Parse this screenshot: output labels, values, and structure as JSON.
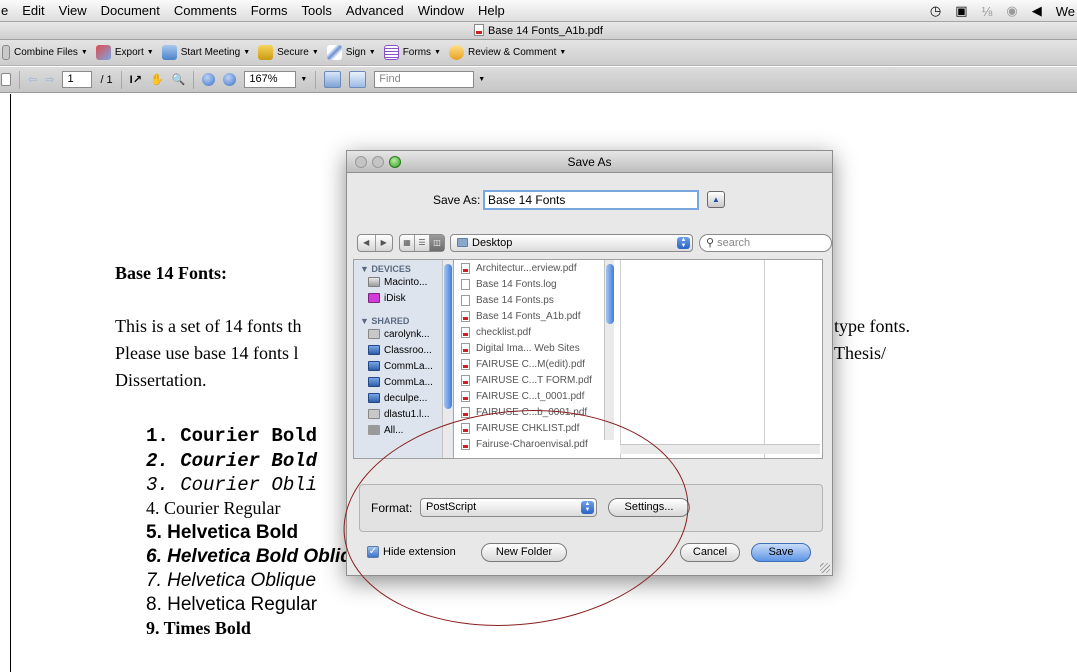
{
  "menubar": {
    "items": [
      "e",
      "Edit",
      "View",
      "Document",
      "Comments",
      "Forms",
      "Tools",
      "Advanced",
      "Window",
      "Help"
    ],
    "right_text": "We"
  },
  "window": {
    "title": "Base 14 Fonts_A1b.pdf"
  },
  "toolbar1": {
    "buttons": [
      "Combine Files",
      "Export",
      "Start Meeting",
      "Secure",
      "Sign",
      "Forms",
      "Review & Comment"
    ]
  },
  "toolbar2": {
    "page": "1",
    "page_total": "/ 1",
    "zoom": "167%",
    "find_placeholder": "Find"
  },
  "document": {
    "heading": "Base 14 Fonts:",
    "para_line1_left": "This is a set of 14 fonts th",
    "para_line1_right": "type fonts.",
    "para_line2_left": "Please use base 14 fonts l",
    "para_line2_right": "Thesis/",
    "para_line3": "Dissertation.",
    "fonts": [
      "1. Courier Bold",
      "2. Courier Bold",
      "3. Courier Obli",
      "4. Courier Regular",
      "5. Helvetica Bold",
      "6. Helvetica Bold Oblique",
      "7. Helvetica Oblique",
      "8. Helvetica Regular",
      "9. Times Bold"
    ]
  },
  "dialog": {
    "title": "Save As",
    "saveas_label": "Save As:",
    "filename": "Base 14 Fonts",
    "location": "Desktop",
    "search_placeholder": "search",
    "sidebar": {
      "devices_header": "▼ DEVICES",
      "devices": [
        "Macinto...",
        "iDisk"
      ],
      "shared_header": "▼ SHARED",
      "shared": [
        "carolynk...",
        "Classroo...",
        "CommLa...",
        "CommLa...",
        "deculpe...",
        "dlastu1.l...",
        "All..."
      ]
    },
    "files": [
      "Architectur...erview.pdf",
      "Base 14 Fonts.log",
      "Base 14 Fonts.ps",
      "Base 14 Fonts_A1b.pdf",
      "checklist.pdf",
      "Digital Ima... Web Sites",
      "FAIRUSE C...M(edit).pdf",
      "FAIRUSE C...T FORM.pdf",
      "FAIRUSE C...t_0001.pdf",
      "FAIRUSE C...b_0001.pdf",
      "FAIRUSE CHKLIST.pdf",
      "Fairuse-Charoenvisal.pdf"
    ],
    "format_label": "Format:",
    "format_value": "PostScript",
    "settings_label": "Settings...",
    "hide_extension_label": "Hide extension",
    "new_folder_label": "New Folder",
    "cancel_label": "Cancel",
    "save_label": "Save"
  }
}
